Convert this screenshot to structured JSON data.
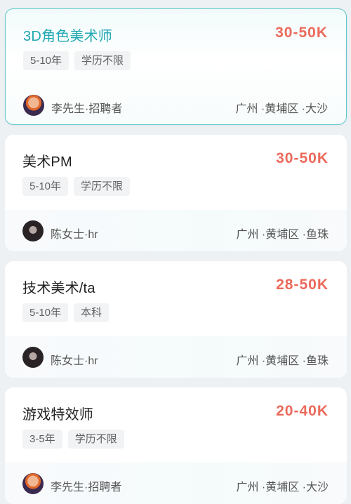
{
  "jobs": [
    {
      "title": "3D角色美术师",
      "salary": "30-50K",
      "tags": [
        "5-10年",
        "学历不限"
      ],
      "recruiter": "李先生·招聘者",
      "location": "广州 ·黄埔区 ·大沙"
    },
    {
      "title": "美术PM",
      "salary": "30-50K",
      "tags": [
        "5-10年",
        "学历不限"
      ],
      "recruiter": "陈女士·hr",
      "location": "广州 ·黄埔区 ·鱼珠"
    },
    {
      "title": "技术美术/ta",
      "salary": "28-50K",
      "tags": [
        "5-10年",
        "本科"
      ],
      "recruiter": "陈女士·hr",
      "location": "广州 ·黄埔区 ·鱼珠"
    },
    {
      "title": "游戏特效师",
      "salary": "20-40K",
      "tags": [
        "3-5年",
        "学历不限"
      ],
      "recruiter": "李先生·招聘者",
      "location": "广州 ·黄埔区 ·大沙"
    }
  ],
  "colors": {
    "accent": "#1fa7b2",
    "salary": "#ec6a5c",
    "selected_border": "#5fc9cc"
  }
}
